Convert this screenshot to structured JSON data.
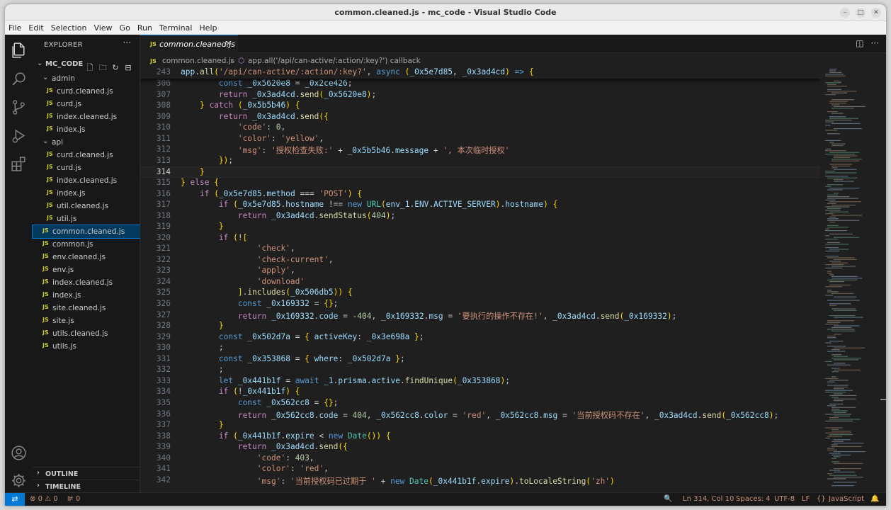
{
  "window": {
    "title": "common.cleaned.js - mc_code - Visual Studio Code"
  },
  "menu": [
    "File",
    "Edit",
    "Selection",
    "View",
    "Go",
    "Run",
    "Terminal",
    "Help"
  ],
  "activity_icons": [
    "files-icon",
    "search-icon",
    "source-control-icon",
    "run-debug-icon",
    "extensions-icon",
    "account-icon",
    "settings-gear-icon"
  ],
  "explorer": {
    "title": "EXPLORER",
    "more": "···",
    "root": "MC_CODE",
    "items": [
      {
        "label": "admin",
        "type": "folder",
        "depth": 1
      },
      {
        "label": "curd.cleaned.js",
        "type": "file",
        "depth": 2
      },
      {
        "label": "curd.js",
        "type": "file",
        "depth": 2
      },
      {
        "label": "index.cleaned.js",
        "type": "file",
        "depth": 2
      },
      {
        "label": "index.js",
        "type": "file",
        "depth": 2
      },
      {
        "label": "api",
        "type": "folder",
        "depth": 1
      },
      {
        "label": "curd.cleaned.js",
        "type": "file",
        "depth": 2
      },
      {
        "label": "curd.js",
        "type": "file",
        "depth": 2
      },
      {
        "label": "index.cleaned.js",
        "type": "file",
        "depth": 2
      },
      {
        "label": "index.js",
        "type": "file",
        "depth": 2
      },
      {
        "label": "util.cleaned.js",
        "type": "file",
        "depth": 2
      },
      {
        "label": "util.js",
        "type": "file",
        "depth": 2
      },
      {
        "label": "common.cleaned.js",
        "type": "file",
        "depth": 1,
        "selected": true
      },
      {
        "label": "common.js",
        "type": "file",
        "depth": 1
      },
      {
        "label": "env.cleaned.js",
        "type": "file",
        "depth": 1
      },
      {
        "label": "env.js",
        "type": "file",
        "depth": 1
      },
      {
        "label": "index.cleaned.js",
        "type": "file",
        "depth": 1
      },
      {
        "label": "index.js",
        "type": "file",
        "depth": 1
      },
      {
        "label": "site.cleaned.js",
        "type": "file",
        "depth": 1
      },
      {
        "label": "site.js",
        "type": "file",
        "depth": 1
      },
      {
        "label": "utils.cleaned.js",
        "type": "file",
        "depth": 1
      },
      {
        "label": "utils.js",
        "type": "file",
        "depth": 1
      }
    ],
    "file_badge": "JS",
    "outline": "OUTLINE",
    "timeline": "TIMELINE"
  },
  "tab": {
    "label": "common.cleaned.js",
    "badge": "JS"
  },
  "breadcrumb": {
    "file": "common.cleaned.js",
    "symbol": "app.all('/api/can-active/:action/:key?') callback"
  },
  "sticky_line": {
    "number": "243",
    "code": "app.all('/api/can-active/:action/:key?', async (_0x5e7d85, _0x3ad4cd) => {"
  },
  "code_lines": [
    {
      "n": "306",
      "code": "        const _0x5620e8 = _0x2ce426;"
    },
    {
      "n": "307",
      "code": "        return _0x3ad4cd.send(_0x5620e8);"
    },
    {
      "n": "308",
      "code": "    } catch (_0x5b5b46) {"
    },
    {
      "n": "309",
      "code": "        return _0x3ad4cd.send({"
    },
    {
      "n": "310",
      "code": "            'code': 0,"
    },
    {
      "n": "311",
      "code": "            'color': 'yellow',"
    },
    {
      "n": "312",
      "code": "            'msg': '授权检查失败:' + _0x5b5b46.message + ', 本次临时授权'"
    },
    {
      "n": "313",
      "code": "        });"
    },
    {
      "n": "314",
      "code": "    }"
    },
    {
      "n": "315",
      "code": "} else {"
    },
    {
      "n": "316",
      "code": "    if (_0x5e7d85.method === 'POST') {"
    },
    {
      "n": "317",
      "code": "        if (_0x5e7d85.hostname !== new URL(env_1.ENV.ACTIVE_SERVER).hostname) {"
    },
    {
      "n": "318",
      "code": "            return _0x3ad4cd.sendStatus(404);"
    },
    {
      "n": "319",
      "code": "        }"
    },
    {
      "n": "320",
      "code": "        if (!["
    },
    {
      "n": "321",
      "code": "                'check',"
    },
    {
      "n": "322",
      "code": "                'check-current',"
    },
    {
      "n": "323",
      "code": "                'apply',"
    },
    {
      "n": "324",
      "code": "                'download'"
    },
    {
      "n": "325",
      "code": "            ].includes(_0x506db5)) {"
    },
    {
      "n": "326",
      "code": "            const _0x169332 = {};"
    },
    {
      "n": "327",
      "code": "            return _0x169332.code = -404, _0x169332.msg = '要执行的操作不存在!', _0x3ad4cd.send(_0x169332);"
    },
    {
      "n": "328",
      "code": "        }"
    },
    {
      "n": "329",
      "code": "        const _0x502d7a = { activeKey: _0x3e698a };"
    },
    {
      "n": "330",
      "code": "        ;"
    },
    {
      "n": "331",
      "code": "        const _0x353868 = { where: _0x502d7a };"
    },
    {
      "n": "332",
      "code": "        ;"
    },
    {
      "n": "333",
      "code": "        let _0x441b1f = await _1.prisma.active.findUnique(_0x353868);"
    },
    {
      "n": "334",
      "code": "        if (!_0x441b1f) {"
    },
    {
      "n": "335",
      "code": "            const _0x562cc8 = {};"
    },
    {
      "n": "336",
      "code": "            return _0x562cc8.code = 404, _0x562cc8.color = 'red', _0x562cc8.msg = '当前授权码不存在', _0x3ad4cd.send(_0x562cc8);"
    },
    {
      "n": "337",
      "code": "        }"
    },
    {
      "n": "338",
      "code": "        if (_0x441b1f.expire < new Date()) {"
    },
    {
      "n": "339",
      "code": "            return _0x3ad4cd.send({"
    },
    {
      "n": "340",
      "code": "                'code': 403,"
    },
    {
      "n": "341",
      "code": "                'color': 'red',"
    },
    {
      "n": "342",
      "code": "                'msg': '当前授权码已过期于 ' + new Date(_0x441b1f.expire).toLocaleString('zh')"
    }
  ],
  "current_line": "314",
  "status": {
    "errors": "0",
    "warnings": "0",
    "ports": "0",
    "position": "Ln 314, Col 10",
    "spaces": "Spaces: 4",
    "encoding": "UTF-8",
    "eol": "LF",
    "language": "JavaScript"
  }
}
